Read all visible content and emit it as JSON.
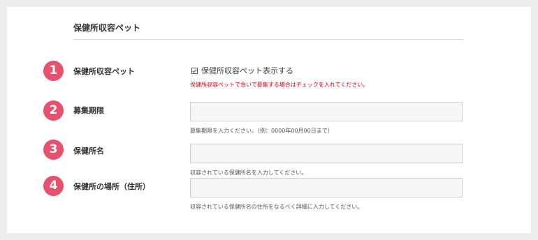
{
  "section": {
    "title": "保健所収容ペット"
  },
  "fields": [
    {
      "number": "1",
      "label": "保健所収容ペット",
      "checkbox_label": "保健所収容ペット表示する",
      "checked": true,
      "note": "保健所収容ペットで急いで募集する場合はチェックを入れてください。",
      "note_color": "#e60012"
    },
    {
      "number": "2",
      "label": "募集期限",
      "value": "",
      "help": "募集期限を入力ください。（例：0000年00月00日まで）"
    },
    {
      "number": "3",
      "label": "保健所名",
      "value": "",
      "help": "収容されている保健所名を入力してください。"
    },
    {
      "number": "4",
      "label": "保健所の場所（住所）",
      "value": "",
      "help": "収容されている保健所名の住所をなるべく詳細に入力してください。"
    }
  ],
  "colors": {
    "badge": "#e8516e",
    "warning": "#e60012",
    "background": "#ececec",
    "input_bg": "#f6f6f6"
  }
}
